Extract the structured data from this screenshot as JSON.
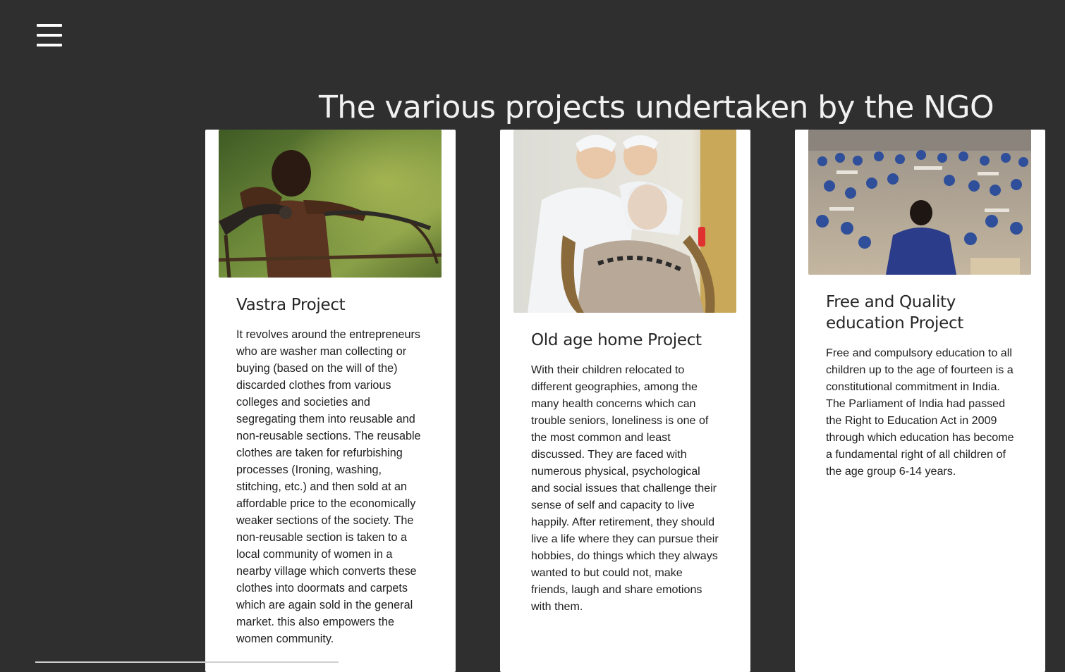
{
  "header": {
    "menu_icon": "hamburger-menu-icon",
    "title": "The various projects undertaken by the NGO"
  },
  "projects": [
    {
      "image_icon": "boy-with-bicycle-photo",
      "title": "Vastra Project",
      "description": "It revolves around the entrepreneurs who are washer man collecting or buying (based on the will of the) discarded clothes from various colleges and societies and segregating them into reusable and non-reusable sections. The reusable clothes are taken for refurbishing processes (Ironing, washing, stitching, etc.) and then sold at an affordable price to the economically weaker sections of the society. The non-reusable section is taken to a local community of women in a nearby village which converts these clothes into doormats and carpets which are again sold in the general market. this also empowers the women community."
    },
    {
      "image_icon": "nurses-with-elderly-woman-photo",
      "title": "Old age home Project",
      "description": "With their children relocated to different geographies, among the many health concerns which can trouble seniors, loneliness is one of the most common and least discussed. They are faced with numerous physical, psychological and social issues that challenge their sense of self and capacity to live happily. After retirement, they should live a life where they can pursue their hobbies, do things which they always wanted to but could not, make friends, laugh and share emotions with them."
    },
    {
      "image_icon": "classroom-children-photo",
      "title": "Free and Quality education Project",
      "description": "Free and compulsory education to all children up to the age of fourteen is a constitutional commitment in India. The Parliament of India had passed the Right to Education Act in 2009 through which education has become a fundamental right of all children of the age group 6-14 years."
    }
  ],
  "colors": {
    "background": "#2f2f2f",
    "card": "#ffffff",
    "title_text": "#f1f1f1",
    "body_text": "#202020"
  }
}
